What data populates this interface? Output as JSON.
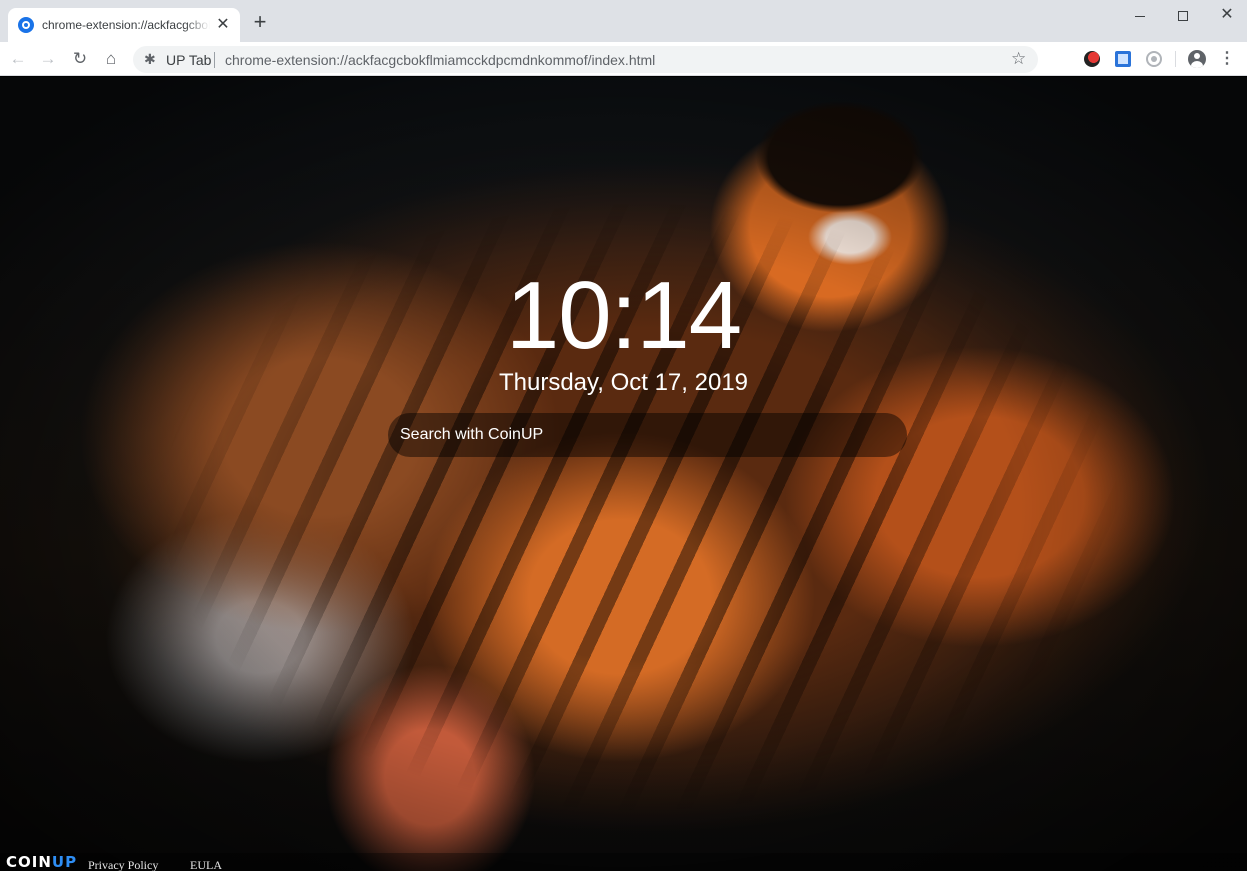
{
  "browser": {
    "tab_title": "chrome-extension://ackfacgcbokflmiamcckdpcmdnkommof/index.html",
    "tab_close": "✕",
    "new_tab": "+",
    "window_close": "✕",
    "site_label": "UP Tab",
    "url": "chrome-extension://ackfacgcbokflmiamcckdpcmdnkommof/index.html",
    "star": "☆",
    "menu": "⋮",
    "back": "←",
    "forward": "→",
    "reload": "↻",
    "home": "⌂",
    "ext_glyph": "✱"
  },
  "newtab": {
    "time": "10:14",
    "date": "Thursday, Oct 17, 2019",
    "search_placeholder": "Search with CoinUP"
  },
  "footer": {
    "logo_main": "COIN",
    "logo_accent": "UP",
    "privacy": "Privacy Policy",
    "eula": "EULA"
  },
  "colors": {
    "accent": "#1a73e8",
    "logo_accent": "#2e8ef5"
  }
}
